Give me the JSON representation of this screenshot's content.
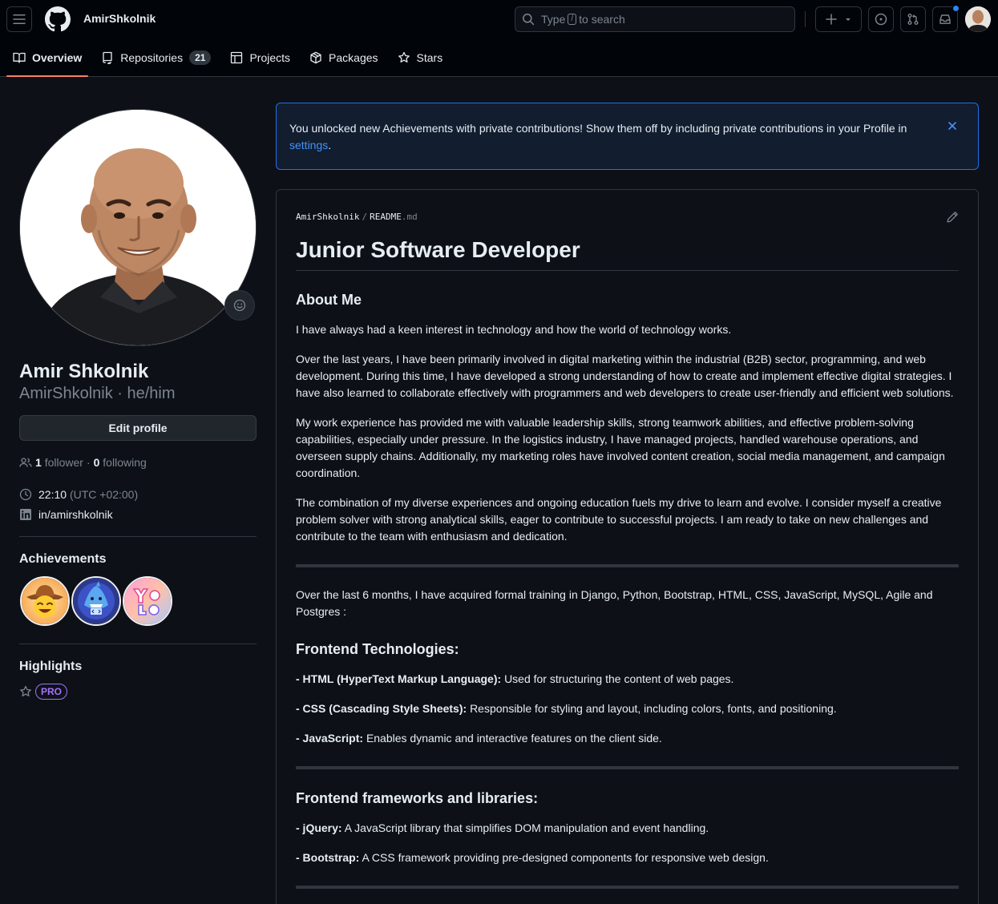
{
  "header": {
    "username": "AmirShkolnik",
    "search": {
      "prefix": "Type",
      "key": "/",
      "suffix": "to search"
    }
  },
  "tabs": [
    {
      "label": "Overview",
      "active": true
    },
    {
      "label": "Repositories",
      "count": "21"
    },
    {
      "label": "Projects"
    },
    {
      "label": "Packages"
    },
    {
      "label": "Stars"
    }
  ],
  "profile": {
    "name": "Amir Shkolnik",
    "login": "AmirShkolnik",
    "pronouns": "he/him",
    "edit_label": "Edit profile",
    "followers": "1",
    "followers_label": "follower",
    "following": "0",
    "following_label": "following",
    "time": "22:10",
    "timezone": "(UTC +02:00)",
    "linkedin": "in/amirshkolnik"
  },
  "achievements": {
    "title": "Achievements",
    "badges": [
      "cowboy-badge",
      "shark-badge",
      "yolo-badge"
    ]
  },
  "highlights": {
    "title": "Highlights",
    "pro_label": "PRO"
  },
  "flash": {
    "message": "You unlocked new Achievements with private contributions! Show them off by including private contributions in your Profile in",
    "link": "settings",
    "end": "."
  },
  "readme": {
    "path_user": "AmirShkolnik",
    "path_sep": "/",
    "path_file": "README",
    "path_ext": ".md",
    "title": "Junior Software Developer",
    "about_heading": "About Me",
    "paragraphs": [
      "I have always had a keen interest in technology and how the world of technology works.",
      "Over the last years, I have been primarily involved in digital marketing within the industrial (B2B) sector, programming, and web development. During this time, I have developed a strong understanding of how to create and implement effective digital strategies. I have also learned to collaborate effectively with programmers and web developers to create user-friendly and efficient web solutions.",
      "My work experience has provided me with valuable leadership skills, strong teamwork abilities, and effective problem-solving capabilities, especially under pressure. In the logistics industry, I have managed projects, handled warehouse operations, and overseen supply chains. Additionally, my marketing roles have involved content creation, social media management, and campaign coordination.",
      "The combination of my diverse experiences and ongoing education fuels my drive to learn and evolve. I consider myself a creative problem solver with strong analytical skills, eager to contribute to successful projects. I am ready to take on new challenges and contribute to the team with enthusiasm and dedication."
    ],
    "training": "Over the last 6 months, I have acquired formal training in Django, Python, Bootstrap, HTML, CSS, JavaScript, MySQL, Agile and Postgres :",
    "frontend_heading": "Frontend Technologies:",
    "frontend": [
      {
        "term": "- HTML (HyperText Markup Language):",
        "desc": "Used for structuring the content of web pages."
      },
      {
        "term": "- CSS (Cascading Style Sheets):",
        "desc": "Responsible for styling and layout, including colors, fonts, and positioning."
      },
      {
        "term": "- JavaScript:",
        "desc": "Enables dynamic and interactive features on the client side."
      }
    ],
    "frameworks_heading": "Frontend frameworks and libraries:",
    "frameworks": [
      {
        "term": "- jQuery:",
        "desc": "A JavaScript library that simplifies DOM manipulation and event handling."
      },
      {
        "term": "- Bootstrap:",
        "desc": "A CSS framework providing pre-designed components for responsive web design."
      }
    ]
  },
  "colors": {
    "accent": "#f78166",
    "link": "#4493f8",
    "pro": "#a371f7",
    "notify": "#2f81f7"
  }
}
